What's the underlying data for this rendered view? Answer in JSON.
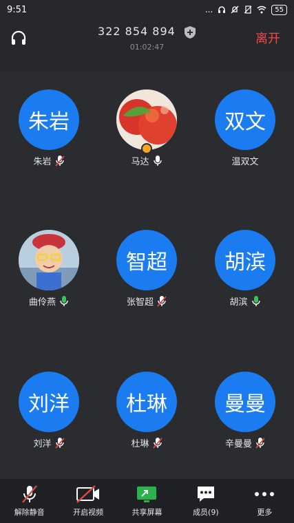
{
  "status": {
    "time": "9:51",
    "dots": "...",
    "battery": "55"
  },
  "header": {
    "meeting_id": "322 854 894",
    "timer": "01:02:47",
    "leave_label": "离开"
  },
  "participants": [
    {
      "avatar_text": "朱岩",
      "name": "朱岩",
      "mic": "muted",
      "photo": false
    },
    {
      "avatar_text": "",
      "name": "马达",
      "mic": "on-white",
      "photo": true,
      "host": true
    },
    {
      "avatar_text": "双文",
      "name": "温双文",
      "mic": "none",
      "photo": false
    },
    {
      "avatar_text": "",
      "name": "曲伶燕",
      "mic": "active",
      "photo": true
    },
    {
      "avatar_text": "智超",
      "name": "张智超",
      "mic": "muted",
      "photo": false
    },
    {
      "avatar_text": "胡滨",
      "name": "胡滨",
      "mic": "active",
      "photo": false
    },
    {
      "avatar_text": "刘洋",
      "name": "刘洋",
      "mic": "muted",
      "photo": false
    },
    {
      "avatar_text": "杜琳",
      "name": "杜琳",
      "mic": "muted",
      "photo": false
    },
    {
      "avatar_text": "曼曼",
      "name": "辛曼曼",
      "mic": "muted",
      "photo": false
    }
  ],
  "toolbar": {
    "unmute": "解除静音",
    "start_video": "开启视频",
    "share_screen": "共享屏幕",
    "members": "成员(9)",
    "more": "更多"
  },
  "colors": {
    "accent": "#1a7cf0",
    "leave": "#f04a4a",
    "mic_active": "#3cc15a",
    "mic_muted": "#e04848",
    "share": "#2bb24c"
  }
}
